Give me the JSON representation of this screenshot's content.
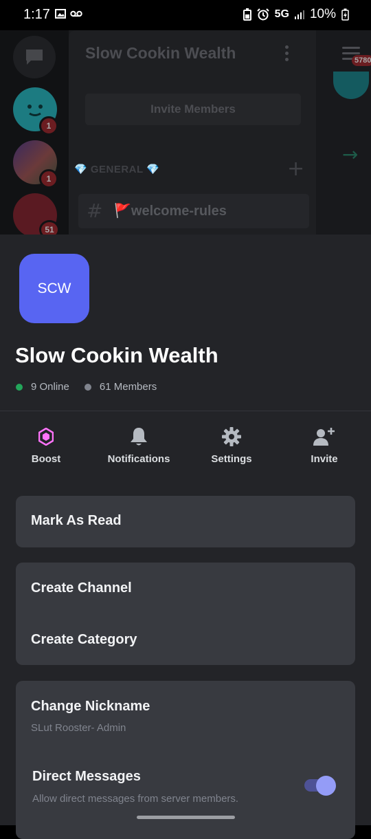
{
  "status_bar": {
    "time": "1:17",
    "network": "5G",
    "battery": "10%"
  },
  "background": {
    "server_name": "Slow Cookin Wealth",
    "invite_button": "Invite Members",
    "category": "💎 GENERAL 💎",
    "channel": "🚩welcome-rules",
    "guild_badges": [
      "1",
      "1",
      "51"
    ],
    "mention_count": "5780"
  },
  "sheet": {
    "icon_text": "SCW",
    "server_name": "Slow Cookin Wealth",
    "online": "9 Online",
    "members": "61 Members",
    "actions": [
      {
        "label": "Boost",
        "icon": "boost-icon"
      },
      {
        "label": "Notifications",
        "icon": "bell-icon"
      },
      {
        "label": "Settings",
        "icon": "gear-icon"
      },
      {
        "label": "Invite",
        "icon": "add-user-icon"
      }
    ],
    "mark_as_read": "Mark As Read",
    "create_channel": "Create Channel",
    "create_category": "Create Category",
    "change_nickname": "Change Nickname",
    "nickname": "SLut Rooster- Admin",
    "direct_messages": "Direct Messages",
    "direct_messages_desc": "Allow direct messages from server members.",
    "direct_messages_enabled": true
  },
  "colors": {
    "brand": "#5865f2",
    "online": "#23a55a",
    "offline": "#80848e",
    "boost": "#ff73fa",
    "sheet_bg": "#232428",
    "card_bg": "#383a40"
  }
}
